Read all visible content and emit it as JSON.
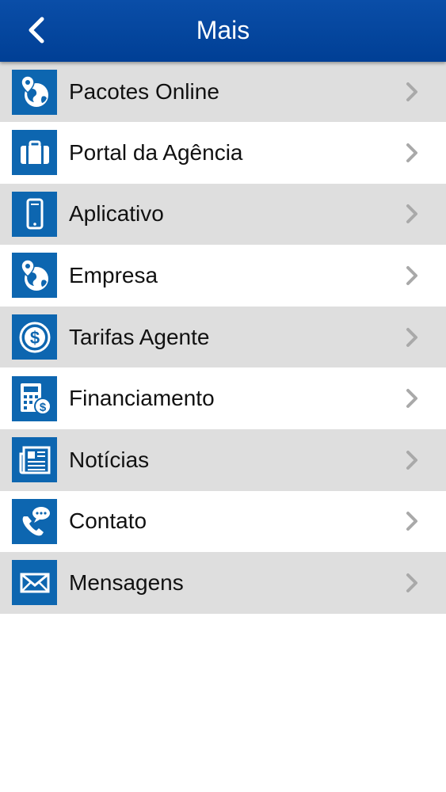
{
  "header": {
    "title": "Mais",
    "back_icon": "chevron-left-icon"
  },
  "colors": {
    "nav_bar": "#0a4ea8",
    "icon_tile": "#0d66b0",
    "row_shaded": "#dedede",
    "row_plain": "#ffffff",
    "chevron": "#a9a9a9"
  },
  "menu": {
    "items": [
      {
        "label": "Pacotes Online",
        "icon": "globe-pin-icon"
      },
      {
        "label": "Portal da Agência",
        "icon": "suitcase-icon"
      },
      {
        "label": "Aplicativo",
        "icon": "smartphone-icon"
      },
      {
        "label": "Empresa",
        "icon": "globe-pin-icon"
      },
      {
        "label": "Tarifas Agente",
        "icon": "dollar-coin-icon"
      },
      {
        "label": "Financiamento",
        "icon": "calculator-dollar-icon"
      },
      {
        "label": "Notícias",
        "icon": "newspaper-icon"
      },
      {
        "label": "Contato",
        "icon": "phone-chat-icon"
      },
      {
        "label": "Mensagens",
        "icon": "envelope-icon"
      }
    ]
  }
}
